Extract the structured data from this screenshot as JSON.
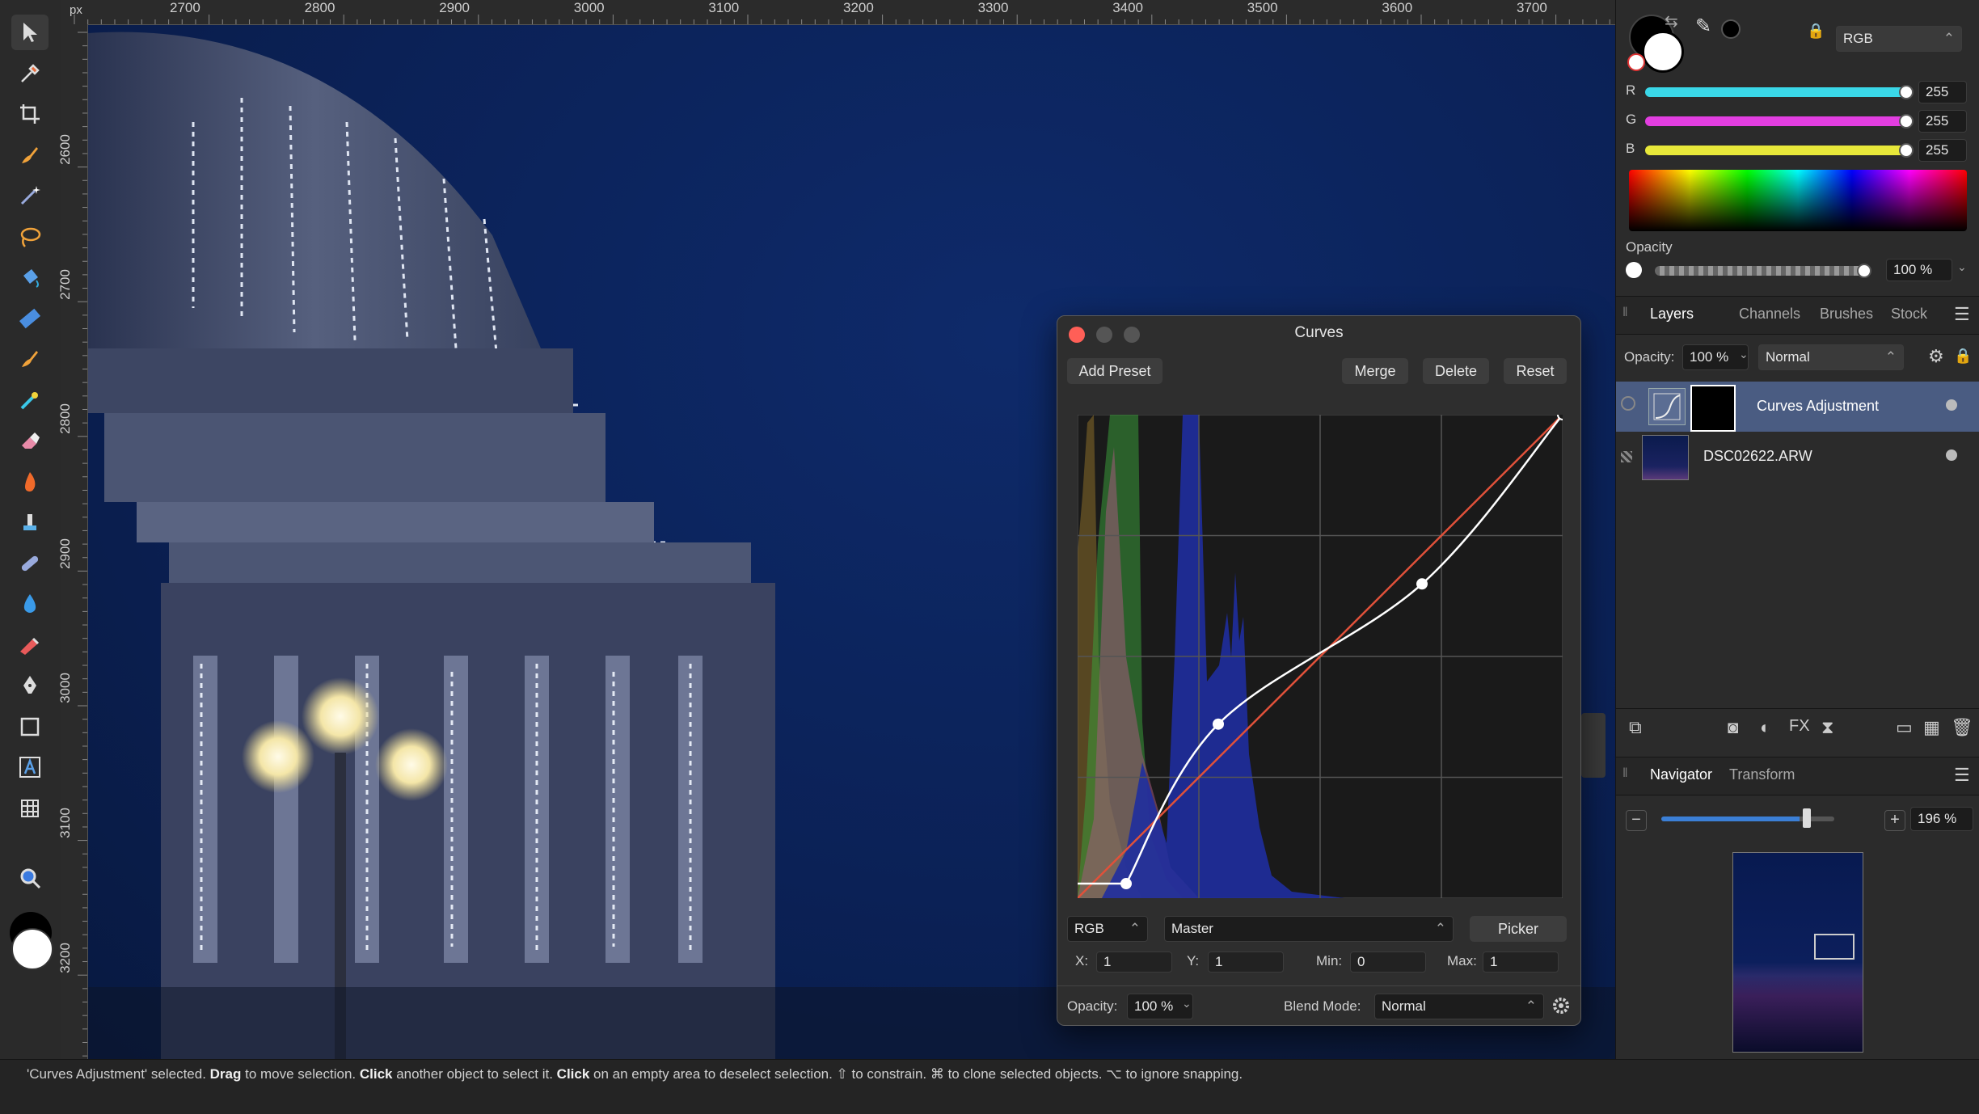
{
  "ruler": {
    "unit": "px",
    "top_labels": [
      "2700",
      "2800",
      "2900",
      "3000",
      "3100",
      "3200",
      "3300",
      "3400",
      "3500",
      "3600",
      "3700"
    ],
    "left_labels": [
      "2600",
      "2700",
      "2800",
      "2900",
      "3000",
      "3100",
      "3200"
    ]
  },
  "tools": [
    {
      "name": "move-tool-icon",
      "glyph": "arrow",
      "active": true
    },
    {
      "name": "color-picker-tool-icon",
      "glyph": "eyedropper"
    },
    {
      "name": "crop-tool-icon",
      "glyph": "crop"
    },
    {
      "name": "selection-brush-tool-icon",
      "glyph": "brush"
    },
    {
      "name": "magic-wand-tool-icon",
      "glyph": "wand"
    },
    {
      "name": "freehand-selection-tool-icon",
      "glyph": "lasso"
    },
    {
      "name": "flood-fill-tool-icon",
      "glyph": "bucket"
    },
    {
      "name": "gradient-tool-icon",
      "glyph": "gradient"
    },
    {
      "name": "paint-brush-tool-icon",
      "glyph": "brush"
    },
    {
      "name": "pixel-tool-icon",
      "glyph": "pixel"
    },
    {
      "name": "erase-brush-tool-icon",
      "glyph": "eraser"
    },
    {
      "name": "burn-brush-tool-icon",
      "glyph": "flame"
    },
    {
      "name": "clone-brush-tool-icon",
      "glyph": "stamp"
    },
    {
      "name": "healing-brush-tool-icon",
      "glyph": "bandage"
    },
    {
      "name": "blur-brush-tool-icon",
      "glyph": "drop"
    },
    {
      "name": "red-eye-tool-icon",
      "glyph": "eye"
    },
    {
      "name": "pen-tool-icon",
      "glyph": "pen"
    },
    {
      "name": "rectangle-tool-icon",
      "glyph": "rect"
    },
    {
      "name": "artistic-text-tool-icon",
      "glyph": "text"
    },
    {
      "name": "mesh-warp-tool-icon",
      "glyph": "grid"
    },
    {
      "name": "zoom-tool-icon",
      "glyph": "zoom"
    }
  ],
  "color": {
    "mode": "RGB",
    "r": {
      "label": "R",
      "value": "255",
      "color": "#3ad7e8"
    },
    "g": {
      "label": "G",
      "value": "255",
      "color": "#e23ee0"
    },
    "b": {
      "label": "B",
      "value": "255",
      "color": "#e8e83a"
    },
    "opacity_label": "Opacity",
    "opacity_value": "100 %",
    "opacity_level": 1.0
  },
  "layers_panel": {
    "tabs": [
      "Layers",
      "Channels",
      "Brushes",
      "Stock"
    ],
    "active_tab": "Layers",
    "opacity_label": "Opacity:",
    "opacity_value": "100 %",
    "blend_mode": "Normal",
    "layers": [
      {
        "name": "Curves Adjustment",
        "selected": true
      },
      {
        "name": "DSC02622.ARW",
        "selected": false
      }
    ]
  },
  "navigator": {
    "tabs": [
      "Navigator",
      "Transform"
    ],
    "active_tab": "Navigator",
    "zoom": "196 %",
    "zoom_level": 0.82
  },
  "curves": {
    "title": "Curves",
    "add_preset": "Add Preset",
    "merge": "Merge",
    "delete": "Delete",
    "reset": "Reset",
    "channel": "RGB",
    "target": "Master",
    "picker": "Picker",
    "x_label": "X:",
    "x_value": "1",
    "y_label": "Y:",
    "y_value": "1",
    "min_label": "Min:",
    "min_value": "0",
    "max_label": "Max:",
    "max_value": "1",
    "opacity_label": "Opacity:",
    "opacity_value": "100 %",
    "blend_label": "Blend Mode:",
    "blend_value": "Normal",
    "curve_points": [
      [
        0.1,
        0.03
      ],
      [
        0.29,
        0.36
      ],
      [
        0.71,
        0.65
      ],
      [
        1.0,
        1.0
      ]
    ]
  },
  "status": {
    "parts": [
      {
        "t": "'Curves Adjustment' selected. ",
        "b": false
      },
      {
        "t": "Drag",
        "b": true
      },
      {
        "t": " to move selection. ",
        "b": false
      },
      {
        "t": "Click",
        "b": true
      },
      {
        "t": " another object to select it. ",
        "b": false
      },
      {
        "t": "Click",
        "b": true
      },
      {
        "t": " on an empty area to deselect selection. ⇧ to constrain. ⌘ to clone selected objects. ⌥ to ignore snapping.",
        "b": false
      }
    ]
  }
}
